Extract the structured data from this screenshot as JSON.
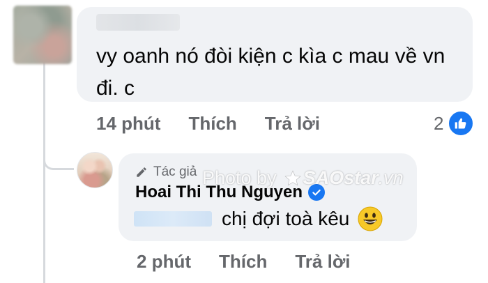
{
  "top_comment": {
    "author_name": "",
    "text": "vy oanh nó đòi kiện c kìa c mau về vn đi. c",
    "time": "14 phút",
    "like_label": "Thích",
    "reply_label": "Trả lời",
    "reaction_count": "2",
    "reaction_icon": "like-icon"
  },
  "reply": {
    "author_badge": "Tác giả",
    "author_name": "Hoai Thi Thu Nguyen",
    "verified_icon": "verified-icon",
    "text": "chị đợi toà kêu",
    "emoji": "grinning-face-emoji",
    "time": "2 phút",
    "like_label": "Thích",
    "reply_label": "Trả lời"
  },
  "watermark": {
    "prefix": "Photo by",
    "brand": "SAOstar",
    "suffix": ".vn"
  },
  "colors": {
    "bubble": "#f0f2f5",
    "meta_text": "#65676b",
    "facebook_blue": "#1877f2"
  }
}
